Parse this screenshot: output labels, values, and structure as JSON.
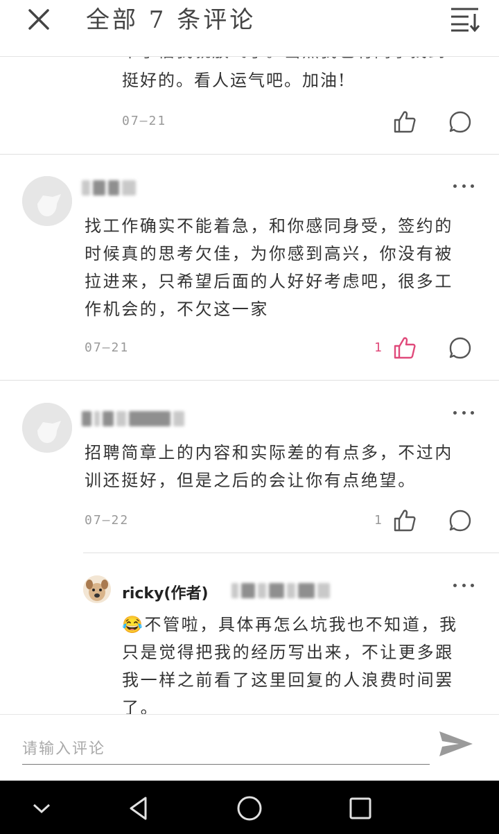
{
  "header": {
    "title": "全部 7 条评论",
    "close_icon": "close-icon",
    "sort_icon": "sort-icon"
  },
  "partial_comment": {
    "cut_line": "卡了估我就放飞了。当然我也有同学找到",
    "visible_line": "挺好的。看人运气吧。加油!",
    "date": "07—21",
    "like_count": ""
  },
  "comments": [
    {
      "lines": [
        "找工作确实不能着急，和你感同身受，签约的",
        "时候真的思考欠佳，为你感到高兴，你没有被",
        "拉进来，只希望后面的人好好考虑吧，很多工",
        "作机会的，不欠这一家"
      ],
      "date": "07—21",
      "like_count": "1",
      "liked": true
    },
    {
      "lines": [
        "招聘简章上的内容和实际差的有点多，不过内",
        "训还挺好，但是之后的会让你有点绝望。"
      ],
      "date": "07—22",
      "like_count": "1",
      "liked": false
    }
  ],
  "reply": {
    "author": "ricky(作者)",
    "lines": [
      "😂不管啦，具体再怎么坑我也不知道，我",
      "只是觉得把我的经历写出来，不让更多跟",
      "我一样之前看了这里回复的人浪费时间罢",
      "了。"
    ]
  },
  "input": {
    "placeholder": "请输入评论",
    "value": ""
  },
  "colors": {
    "like_active": "#e0497a",
    "muted": "#999999",
    "nav_bg": "#000000"
  },
  "navbar": {
    "back_icon": "chevron-down-icon",
    "triangle_icon": "back-triangle-icon",
    "home_icon": "home-circle-icon",
    "recent_icon": "recent-square-icon"
  }
}
